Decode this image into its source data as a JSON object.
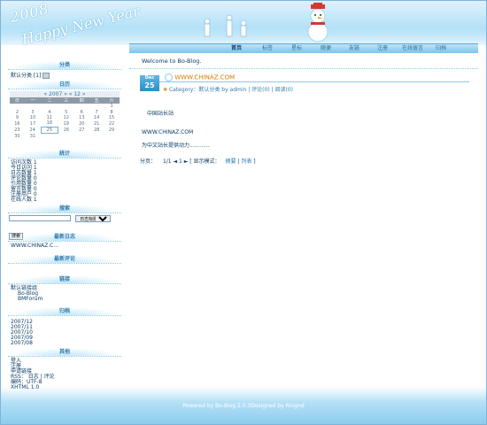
{
  "header": {
    "year": "2008",
    "greeting": "Happy New Year"
  },
  "nav": {
    "items": [
      {
        "label": "首页"
      },
      {
        "label": "标签"
      },
      {
        "label": "星标"
      },
      {
        "label": "随便"
      },
      {
        "label": "友链"
      },
      {
        "label": "注册"
      },
      {
        "label": "在线留言"
      },
      {
        "label": "归档"
      }
    ]
  },
  "sidebar": {
    "category": {
      "title": "分类",
      "item": "默认分类 [1]"
    },
    "calendar": {
      "title": "日历",
      "header": "« 2007 » « 12 »",
      "weekdays": [
        "日",
        "一",
        "二",
        "三",
        "四",
        "五",
        "六"
      ],
      "rows": [
        [
          "",
          "",
          "",
          "",
          "",
          "",
          "1"
        ],
        [
          "2",
          "3",
          "4",
          "5",
          "6",
          "7",
          "8"
        ],
        [
          "9",
          "10",
          "11",
          "12",
          "13",
          "14",
          "15"
        ],
        [
          "16",
          "17",
          "18",
          "19",
          "20",
          "21",
          "22"
        ],
        [
          "23",
          "24",
          "25",
          "26",
          "27",
          "28",
          "29"
        ],
        [
          "30",
          "31",
          "",
          "",
          "",
          "",
          ""
        ]
      ],
      "today": "25"
    },
    "stats": {
      "title": "统计",
      "lines": [
        "访问次数 1",
        "今日访问 1",
        "日志数量 1",
        "评论数量 0",
        "引用数量 0",
        "留言数量 0",
        "注册用户 0",
        "在线人数 1"
      ]
    },
    "search": {
      "title": "搜索",
      "input_value": "",
      "select_value": "日志标题",
      "button": "搜索"
    },
    "latest_posts": {
      "title": "最新日志",
      "item": "WWW.CHINAZ.C..."
    },
    "latest_comments": {
      "title": "最新评论"
    },
    "links": {
      "title": "链接",
      "group": "默认链接组",
      "items": [
        "Bo-Blog",
        "BMForum"
      ]
    },
    "archive": {
      "title": "归档",
      "items": [
        "2007/12",
        "2007/11",
        "2007/10",
        "2007/09",
        "2007/08"
      ]
    },
    "misc": {
      "title": "其他",
      "lines": [
        "登入",
        "注册",
        "申请链接",
        "RSS： 日志 | 评论",
        "编码：UTF-8",
        "XHTML 1.0"
      ]
    }
  },
  "main": {
    "welcome": "Welcome to Bo-Blog.",
    "post": {
      "month": "Dec",
      "day": "25",
      "title": "WWW.CHINAZ.COM",
      "meta": "Category：默认分类 by admin | 评论(0) | 阅读(0)",
      "body": [
        "中国站长站",
        "WWW.CHINAZ.COM",
        "为中文站长提供动力............"
      ]
    },
    "pager": {
      "label": "分页：",
      "pages": "1/1",
      "nav_text": "◄ 1 ► [ 显示模式：",
      "mode_summary": "摘要",
      "sep": "|",
      "mode_list": "列表",
      "end": "]"
    }
  },
  "footer": {
    "text": "Powered by Bo-Blog 2.0.3Designed by Ringnd"
  }
}
